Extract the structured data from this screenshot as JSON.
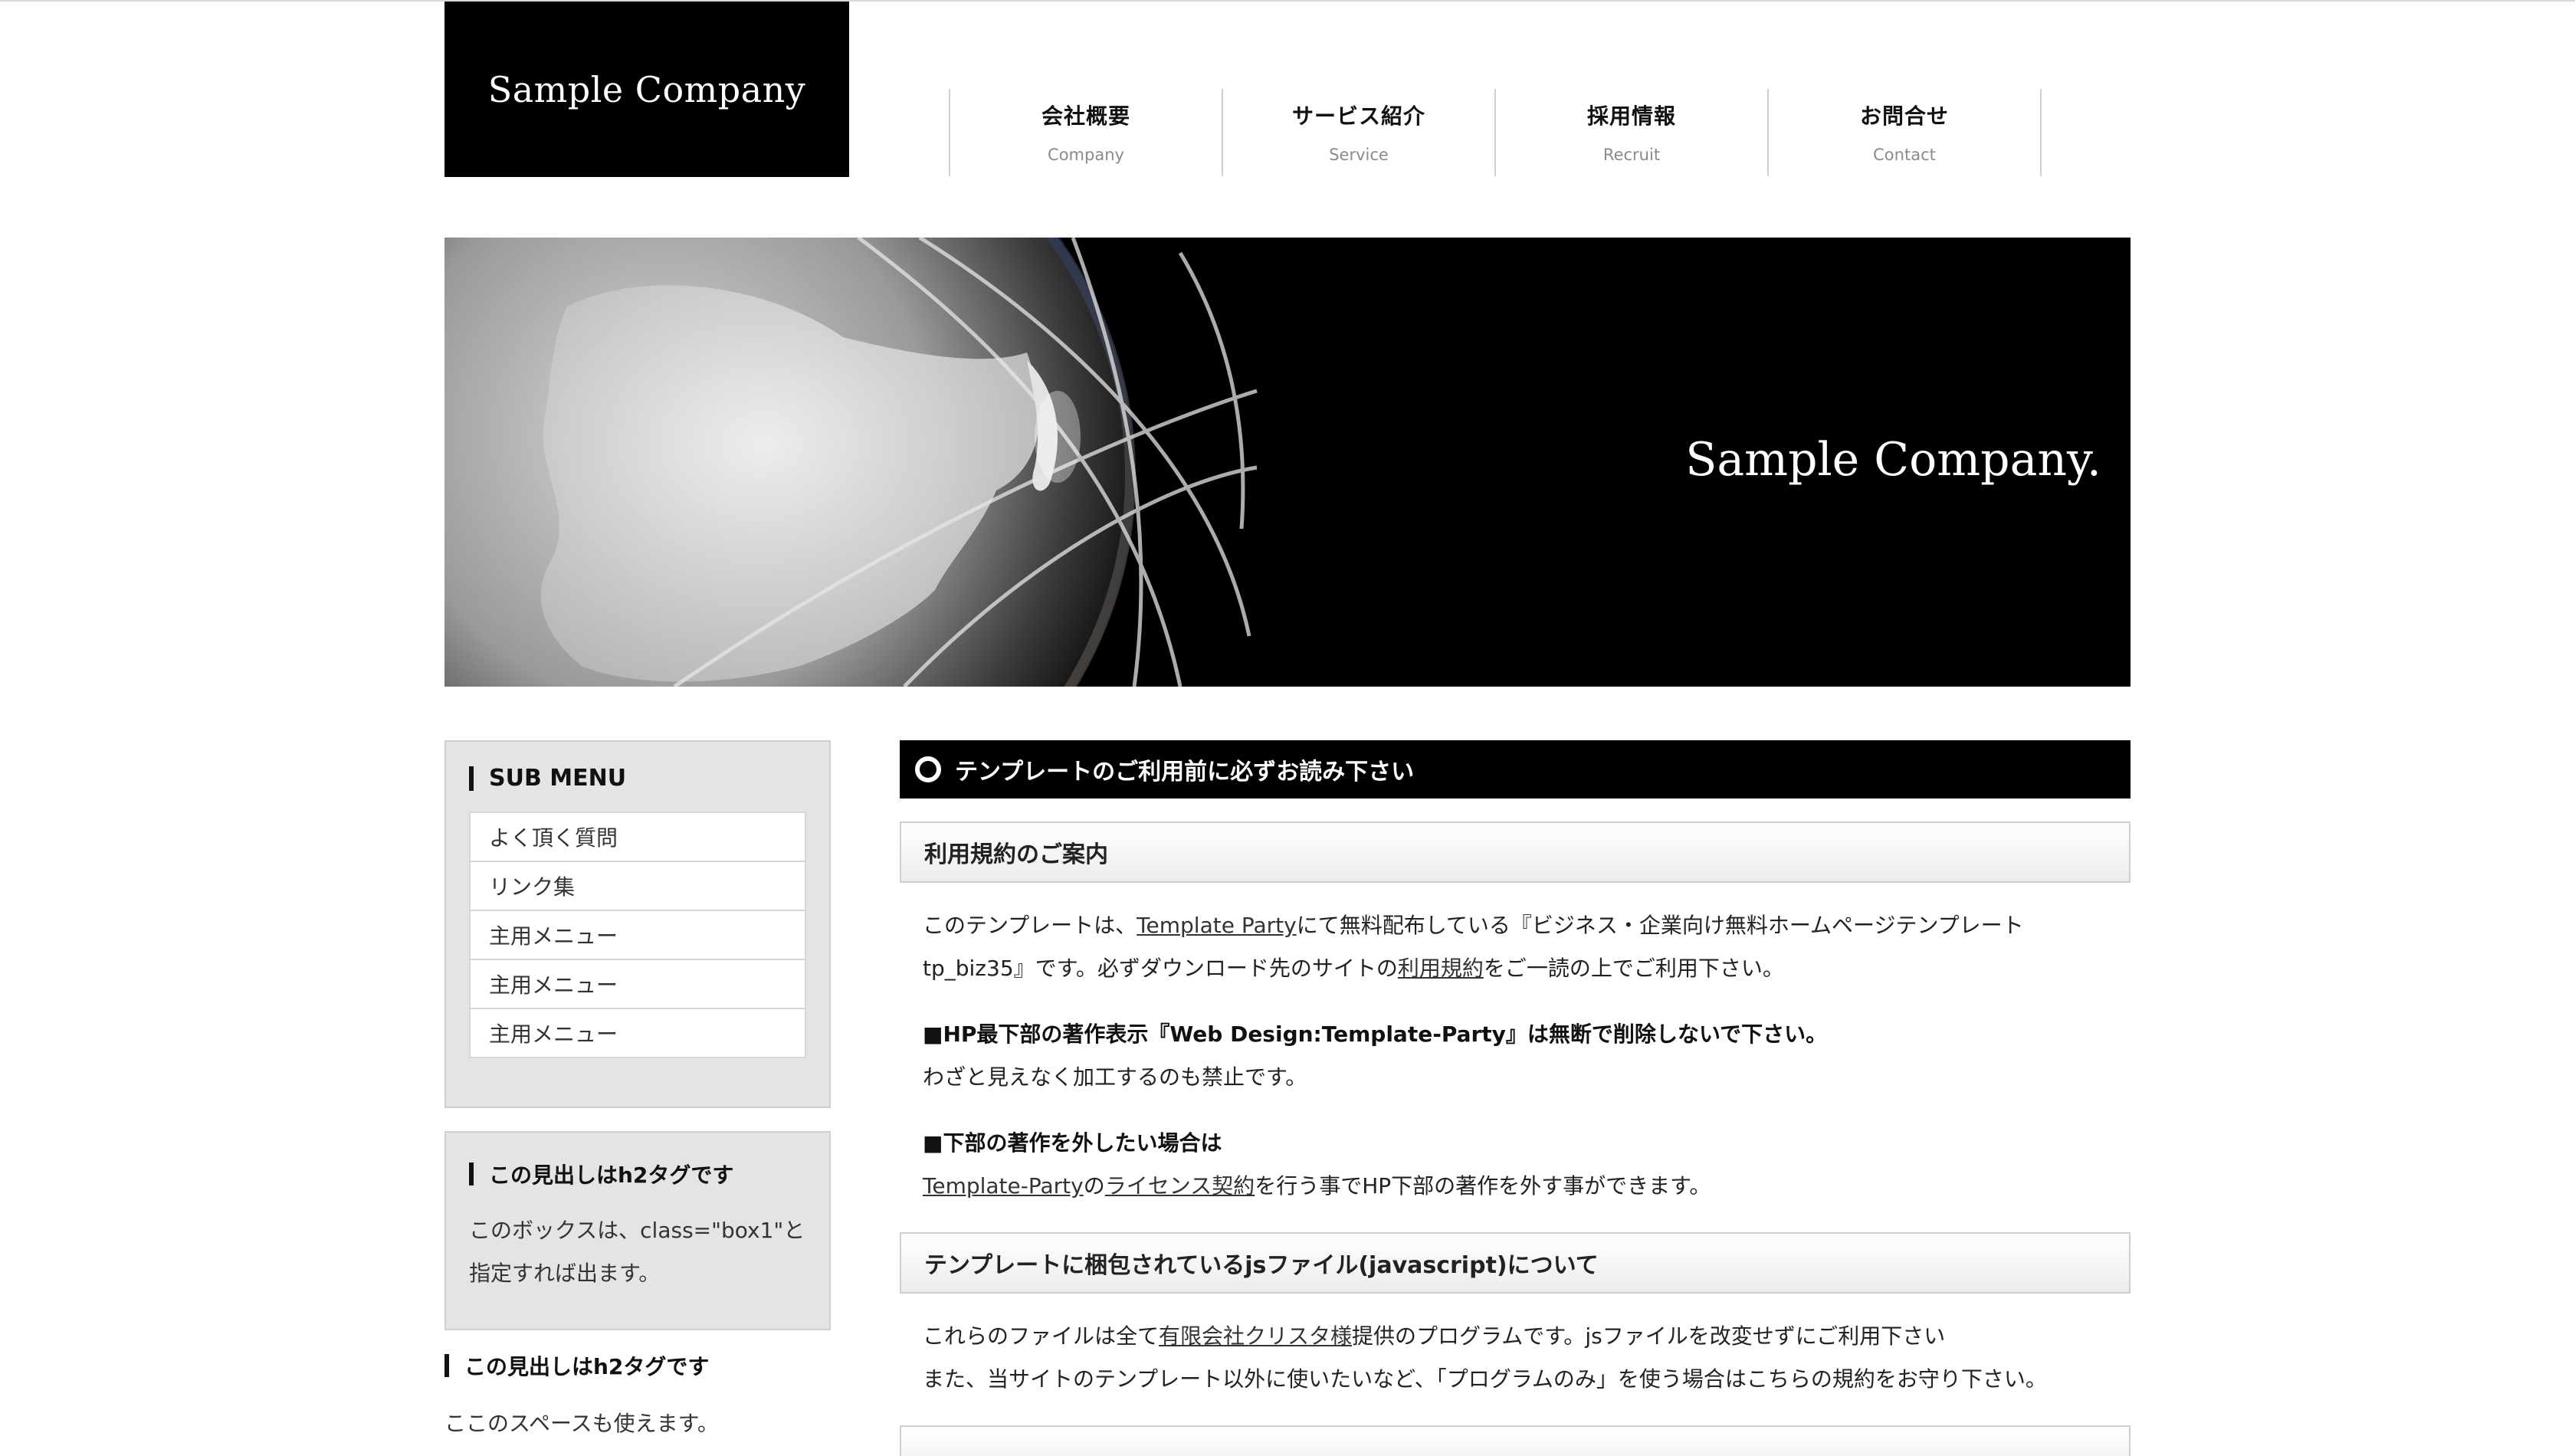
{
  "header": {
    "logo": "Sample Company",
    "nav": [
      {
        "ja": "会社概要",
        "en": "Company"
      },
      {
        "ja": "サービス紹介",
        "en": "Service"
      },
      {
        "ja": "採用情報",
        "en": "Recruit"
      },
      {
        "ja": "お問合せ",
        "en": "Contact"
      }
    ]
  },
  "hero": {
    "caption": "Sample Company."
  },
  "sidebar": {
    "submenu_title": "SUB MENU",
    "submenu_items": [
      "よく頂く質問",
      "リンク集",
      "主用メニュー",
      "主用メニュー",
      "主用メニュー"
    ],
    "box1_title": "この見出しはh2タグです",
    "box1_text_1": "このボックスは、class=\"box1\"と",
    "box1_text_2": "指定すれば出ます。",
    "h2_title": "この見出しはh2タグです",
    "h2_text": "ここのスペースも使えます。"
  },
  "main": {
    "title": "テンプレートのご利用前に必ずお読み下さい",
    "section1": {
      "heading": "利用規約のご案内",
      "p1_a": "このテンプレートは、",
      "p1_link": "Template Party",
      "p1_b": "にて無料配布している『ビジネス・企業向け無料ホームページテンプレート",
      "p1_c": "tp_biz35』です。必ずダウンロード先のサイトの",
      "p1_link2": "利用規約",
      "p1_d": "をご一読の上でご利用下さい。",
      "p2_bold": "■HP最下部の著作表示『Web Design:Template-Party』は無断で削除しないで下さい。",
      "p2_text": "わざと見えなく加工するのも禁止です。",
      "p3_bold": "■下部の著作を外したい場合は",
      "p3_link1": "Template-Party",
      "p3_mid": "の",
      "p3_link2": "ライセンス契約",
      "p3_end": "を行う事でHP下部の著作を外す事ができます。"
    },
    "section2": {
      "heading": "テンプレートに梱包されているjsファイル(javascript)について",
      "p1_a": "これらのファイルは全て",
      "p1_link": "有限会社クリスタ様",
      "p1_b": "提供のプログラムです。jsファイルを改変せずにご利用下さい",
      "p2": "また、当サイトのテンプレート以外に使いたいなど、「プログラムのみ」を使う場合はこちらの規約をお守り下さい。"
    }
  }
}
